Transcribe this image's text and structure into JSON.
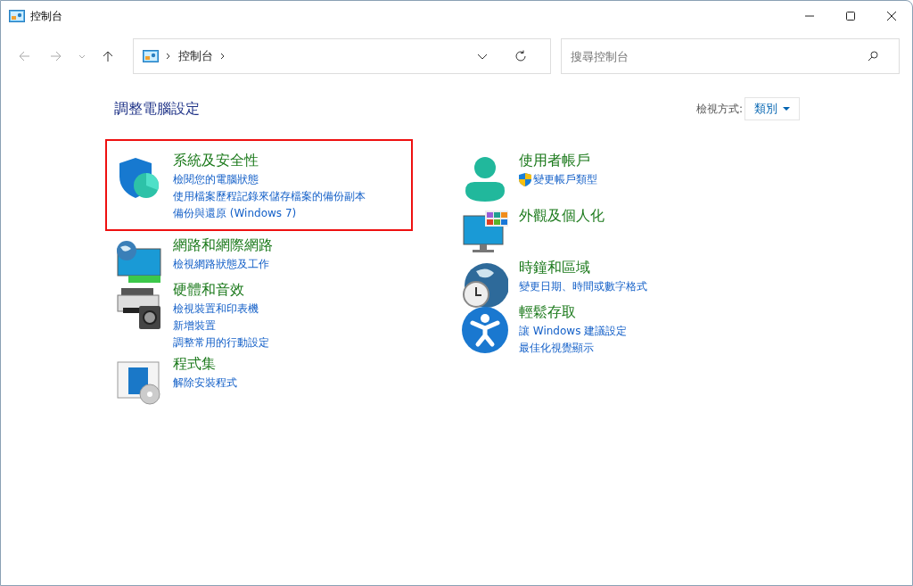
{
  "window": {
    "title": "控制台"
  },
  "address_bar": {
    "breadcrumb": [
      "控制台"
    ]
  },
  "search": {
    "placeholder": "搜尋控制台"
  },
  "heading": "調整電腦設定",
  "view_by": {
    "label": "檢視方式:",
    "value": "類別"
  },
  "columns": [
    {
      "categories": [
        {
          "kind": "security",
          "title": "系統及安全性",
          "highlighted": true,
          "links": [
            {
              "text": "檢閱您的電腦狀態",
              "shield": false
            },
            {
              "text": "使用檔案歷程記錄來儲存檔案的備份副本",
              "shield": false
            },
            {
              "text": "備份與還原 (Windows 7)",
              "shield": false
            }
          ]
        },
        {
          "kind": "network",
          "title": "網路和網際網路",
          "highlighted": false,
          "links": [
            {
              "text": "檢視網路狀態及工作",
              "shield": false
            }
          ]
        },
        {
          "kind": "hardware",
          "title": "硬體和音效",
          "highlighted": false,
          "links": [
            {
              "text": "檢視裝置和印表機",
              "shield": false
            },
            {
              "text": "新增裝置",
              "shield": false
            },
            {
              "text": "調整常用的行動設定",
              "shield": false
            }
          ]
        },
        {
          "kind": "programs",
          "title": "程式集",
          "highlighted": false,
          "links": [
            {
              "text": "解除安裝程式",
              "shield": false
            }
          ]
        }
      ]
    },
    {
      "categories": [
        {
          "kind": "user",
          "title": "使用者帳戶",
          "highlighted": false,
          "links": [
            {
              "text": "變更帳戶類型",
              "shield": true
            }
          ]
        },
        {
          "kind": "appearance",
          "title": "外觀及個人化",
          "highlighted": false
        },
        {
          "kind": "clock",
          "title": "時鐘和區域",
          "highlighted": false,
          "links": [
            {
              "text": "變更日期、時間或數字格式",
              "shield": false
            }
          ]
        },
        {
          "kind": "access",
          "title": "輕鬆存取",
          "highlighted": false,
          "links": [
            {
              "text": "讓 Windows 建議設定",
              "shield": false
            },
            {
              "text": "最佳化視覺顯示",
              "shield": false
            }
          ]
        }
      ]
    }
  ]
}
